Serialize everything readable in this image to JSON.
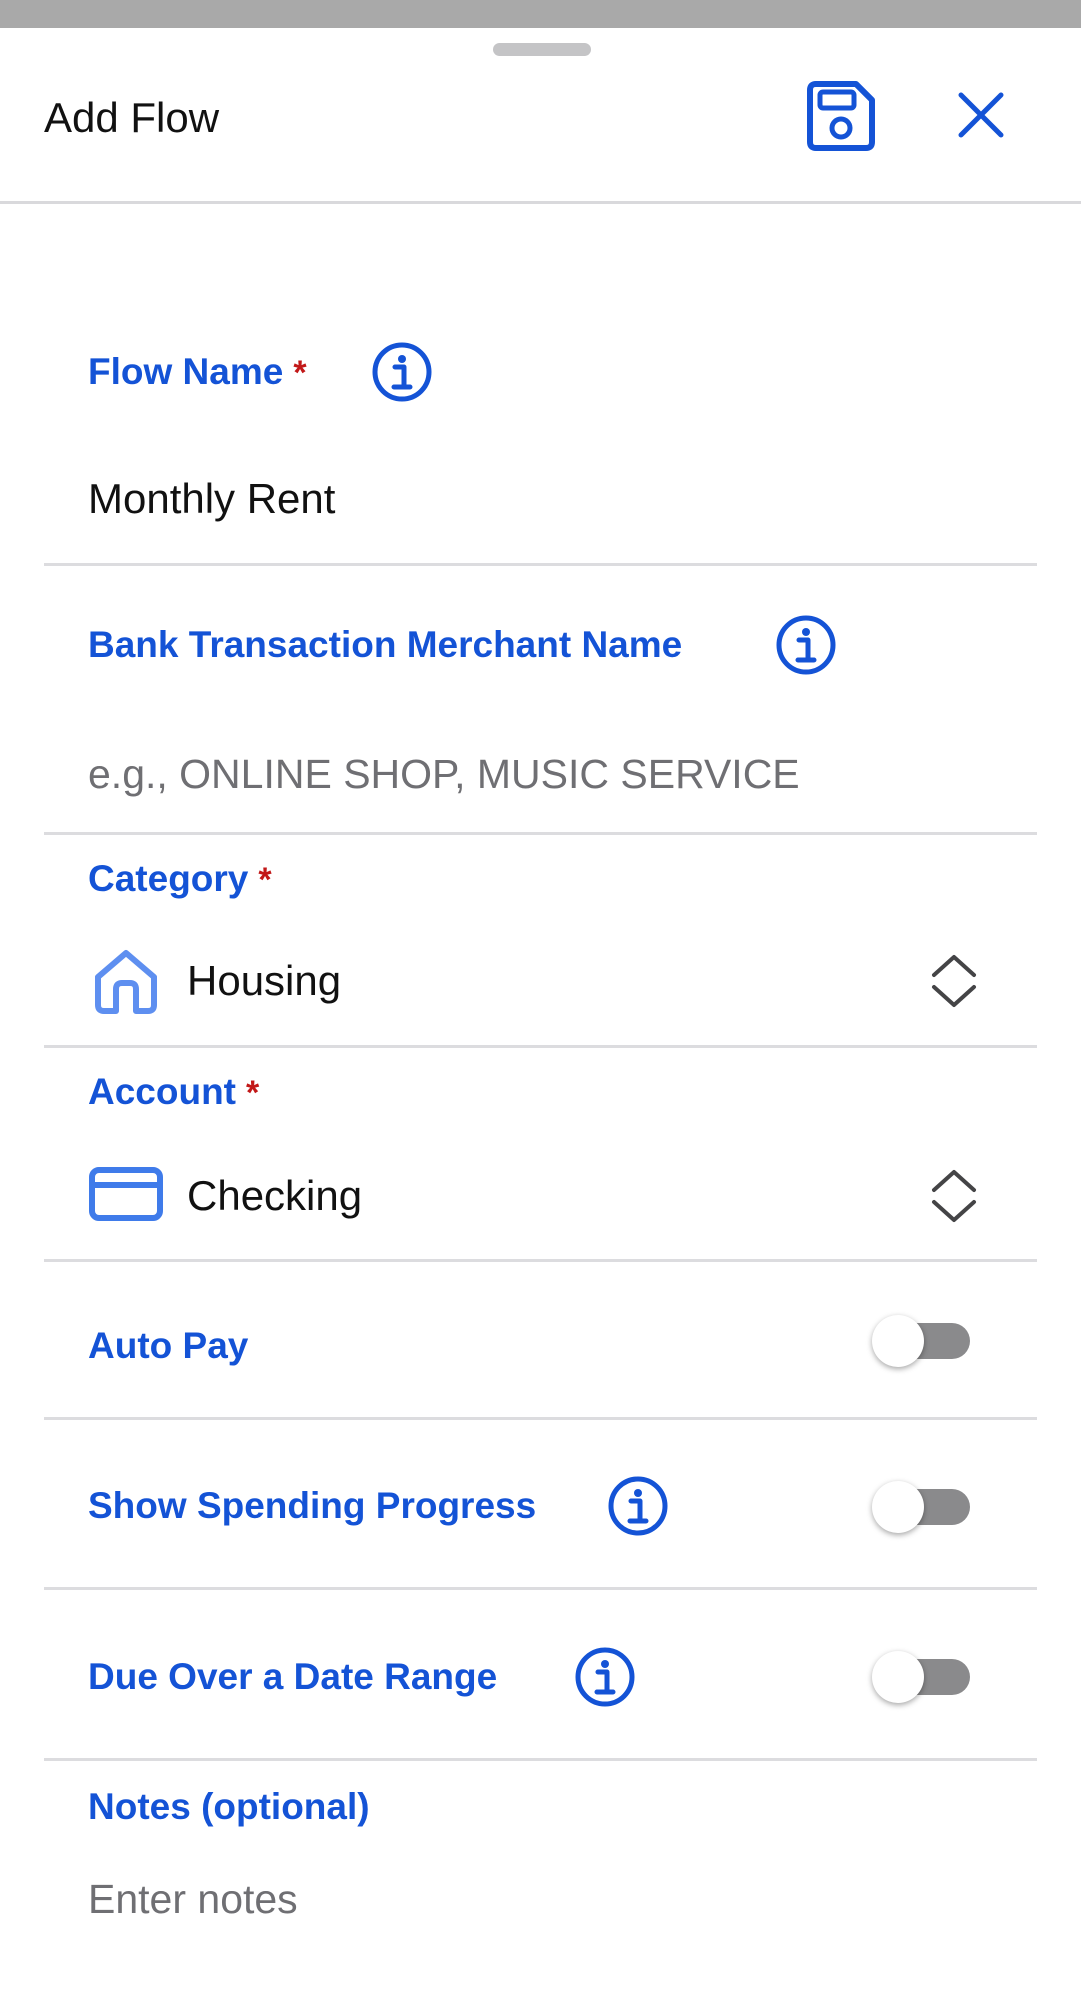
{
  "header": {
    "title": "Add Flow",
    "save_icon": "save-icon",
    "close_icon": "close-icon"
  },
  "fields": {
    "flow_name": {
      "label": "Flow Name",
      "required_mark": "*",
      "value": "Monthly Rent"
    },
    "merchant_name": {
      "label": "Bank Transaction Merchant Name",
      "placeholder": "e.g., ONLINE SHOP, MUSIC SERVICE"
    },
    "category": {
      "label": "Category",
      "required_mark": "*",
      "value": "Housing",
      "icon": "house-icon"
    },
    "account": {
      "label": "Account",
      "required_mark": "*",
      "value": "Checking",
      "icon": "credit-card-icon"
    },
    "auto_pay": {
      "label": "Auto Pay",
      "on": false
    },
    "show_spending_progress": {
      "label": "Show Spending Progress",
      "on": false
    },
    "due_over_date_range": {
      "label": "Due Over a Date Range",
      "on": false
    },
    "notes": {
      "label": "Notes (optional)",
      "placeholder": "Enter notes"
    }
  },
  "colors": {
    "accent": "#1453d6",
    "required": "#c21818",
    "toggle_off_track": "#8a8a8c"
  }
}
